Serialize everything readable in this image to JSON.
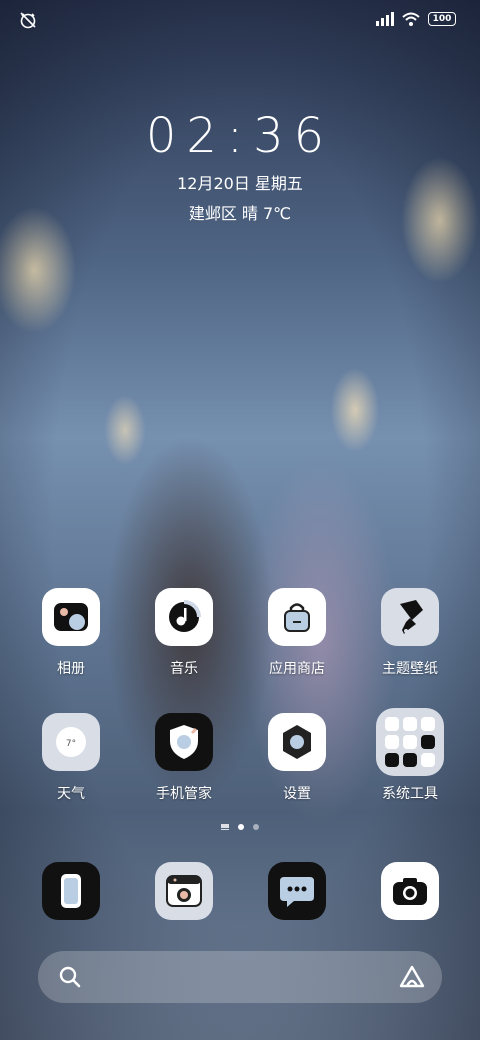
{
  "status": {
    "battery": "100"
  },
  "clock": {
    "time": "02:36",
    "date": "12月20日 星期五",
    "weather": "建邺区 晴 7℃"
  },
  "apps": [
    {
      "label": "相册",
      "icon": "gallery-icon"
    },
    {
      "label": "音乐",
      "icon": "music-icon"
    },
    {
      "label": "应用商店",
      "icon": "app-store-icon"
    },
    {
      "label": "主题壁纸",
      "icon": "theme-icon"
    },
    {
      "label": "天气",
      "icon": "weather-icon"
    },
    {
      "label": "手机管家",
      "icon": "security-icon"
    },
    {
      "label": "设置",
      "icon": "settings-icon"
    },
    {
      "label": "系统工具",
      "icon": "folder-icon"
    }
  ],
  "dock": [
    {
      "icon": "phone-icon"
    },
    {
      "icon": "contacts-icon"
    },
    {
      "icon": "messages-icon"
    },
    {
      "icon": "camera-icon"
    }
  ],
  "colors": {
    "icon_white": "#ffffff",
    "icon_black": "#111111",
    "icon_grey": "#d8dde6"
  }
}
